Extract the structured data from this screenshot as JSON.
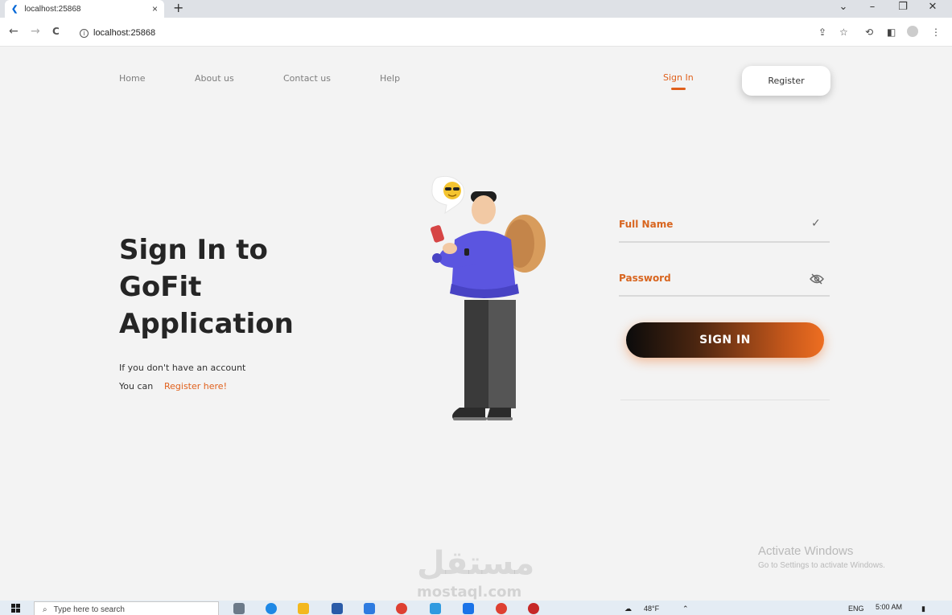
{
  "browser": {
    "tab_title": "localhost:25868",
    "tab_close": "×",
    "new_tab": "+",
    "url": "localhost:25868",
    "window_controls": {
      "collapse": "⌄",
      "minimize": "–",
      "restore": "❐",
      "close": "✕"
    },
    "nav": {
      "back": "←",
      "forward": "→",
      "reload": "C"
    },
    "toolbar_icons": [
      "share-icon",
      "star-icon",
      "extensions-icon",
      "sidepanel-icon",
      "profile-icon",
      "menu-icon"
    ]
  },
  "app": {
    "nav": {
      "home": "Home",
      "about": "About us",
      "contact": "Contact us",
      "help": "Help",
      "sign_in": "Sign In",
      "register": "Register"
    },
    "hero": {
      "line1": "Sign In to",
      "line2": "GoFit",
      "line3": "Application",
      "sub1": "If you don't have an account",
      "sub2": "You can",
      "register_link": "Register here!"
    },
    "form": {
      "full_name_label": "Full Name",
      "password_label": "Password",
      "submit": "SIGN IN"
    },
    "accent_color": "#e0601c"
  },
  "overlay": {
    "activate_title": "Activate Windows",
    "activate_sub": "Go to Settings to activate Windows.",
    "watermark_arabic": "مستقل",
    "watermark_latin": "mostaql.com"
  },
  "taskbar": {
    "search_placeholder": "Type here to search",
    "temperature": "48°F",
    "language": "ENG",
    "time": "5:00 AM"
  }
}
